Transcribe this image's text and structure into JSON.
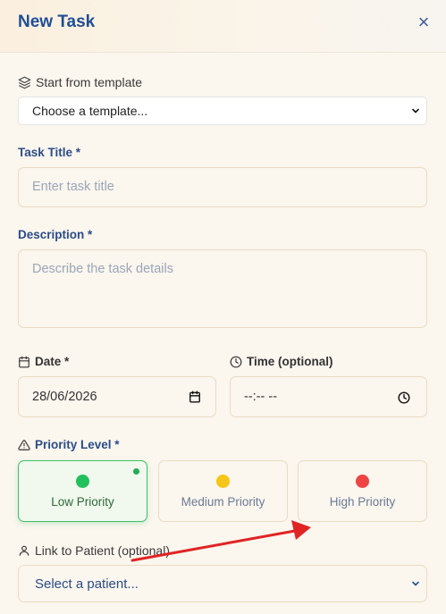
{
  "dialog": {
    "title": "New Task",
    "close_symbol": "×"
  },
  "template": {
    "label": "Start from template",
    "selected": "Choose a template..."
  },
  "task_title": {
    "label": "Task Title *",
    "placeholder": "Enter task title"
  },
  "description": {
    "label": "Description *",
    "placeholder": "Describe the task details"
  },
  "date": {
    "label": "Date *",
    "value": "28/06/2026"
  },
  "time": {
    "label": "Time (optional)",
    "value": "--:-- --"
  },
  "priority": {
    "label": "Priority Level *",
    "options": [
      {
        "label": "Low Priority",
        "color": "#22c05c",
        "selected": true
      },
      {
        "label": "Medium Priority",
        "color": "#f5c518",
        "selected": false
      },
      {
        "label": "High Priority",
        "color": "#ef4444",
        "selected": false
      }
    ]
  },
  "patient": {
    "label": "Link to Patient (optional)",
    "selected": "Select a patient..."
  },
  "icons": {
    "template": "layers-icon",
    "date": "calendar-icon",
    "time": "clock-icon",
    "priority": "warning-triangle-icon",
    "patient": "user-icon"
  },
  "colors": {
    "accent": "#1f4e96",
    "active_border": "#3cc06a",
    "annotation_arrow": "#e02424"
  }
}
